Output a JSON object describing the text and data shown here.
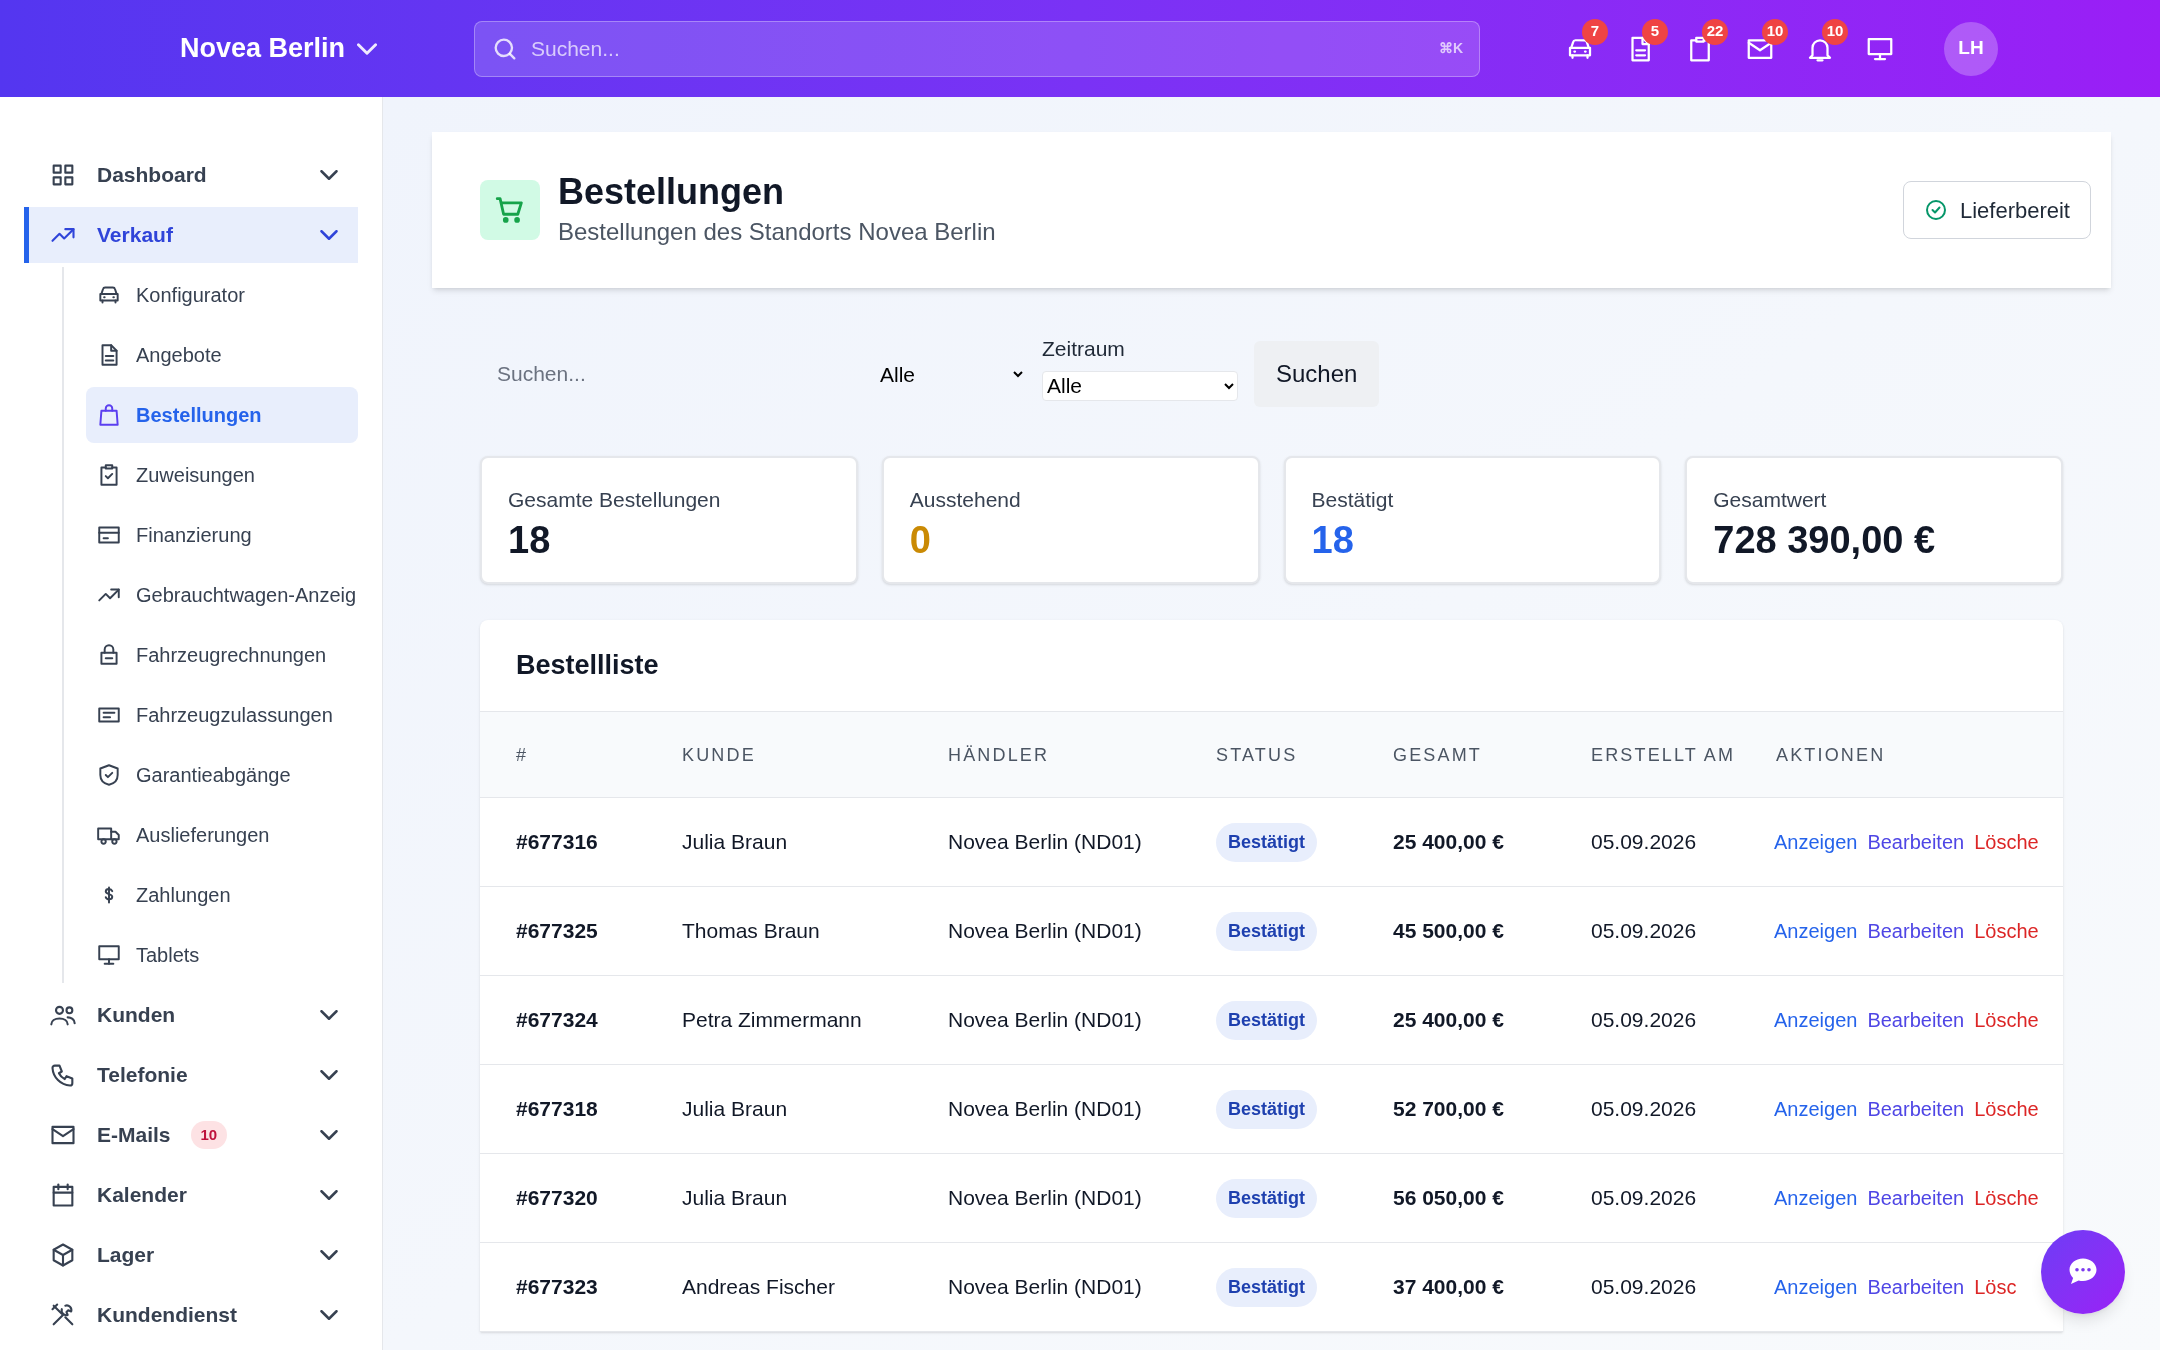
{
  "header": {
    "brand": "Novea Berlin",
    "search": {
      "placeholder": "Suchen...",
      "shortcut": "⌘K"
    },
    "notifications": [
      {
        "count": "7"
      },
      {
        "count": "5"
      },
      {
        "count": "22"
      },
      {
        "count": "10"
      },
      {
        "count": "10"
      }
    ],
    "avatar": "LH"
  },
  "sidebar": {
    "items": [
      {
        "label": "Dashboard",
        "selected": false
      },
      {
        "label": "Verkauf",
        "selected": true,
        "children": [
          {
            "label": "Konfigurator",
            "selected": false
          },
          {
            "label": "Angebote",
            "selected": false
          },
          {
            "label": "Bestellungen",
            "selected": true
          },
          {
            "label": "Zuweisungen",
            "selected": false
          },
          {
            "label": "Finanzierung",
            "selected": false
          },
          {
            "label": "Gebrauchtwagen-Anzeig",
            "selected": false
          },
          {
            "label": "Fahrzeugrechnungen",
            "selected": false
          },
          {
            "label": "Fahrzeugzulassungen",
            "selected": false
          },
          {
            "label": "Garantieabgänge",
            "selected": false
          },
          {
            "label": "Auslieferungen",
            "selected": false
          },
          {
            "label": "Zahlungen",
            "selected": false
          },
          {
            "label": "Tablets",
            "selected": false
          }
        ]
      },
      {
        "label": "Kunden",
        "selected": false
      },
      {
        "label": "Telefonie",
        "selected": false
      },
      {
        "label": "E-Mails",
        "selected": false,
        "badge": "10"
      },
      {
        "label": "Kalender",
        "selected": false
      },
      {
        "label": "Lager",
        "selected": false
      },
      {
        "label": "Kundendienst",
        "selected": false
      }
    ]
  },
  "page": {
    "title": "Bestellungen",
    "subtitle": "Bestellungen des Standorts Novea Berlin",
    "action": "Lieferbereit"
  },
  "filters": {
    "search": {
      "placeholder": "Suchen..."
    },
    "status": {
      "value": "Alle"
    },
    "period": {
      "label": "Zeitraum",
      "value": "Alle"
    },
    "button": "Suchen"
  },
  "stats": [
    {
      "label": "Gesamte Bestellungen",
      "value": "18",
      "color": "#111827"
    },
    {
      "label": "Ausstehend",
      "value": "0",
      "color": "#ca8a04"
    },
    {
      "label": "Bestätigt",
      "value": "18",
      "color": "#2563eb"
    },
    {
      "label": "Gesamtwert",
      "value": "728 390,00 €",
      "color": "#111827"
    }
  ],
  "table": {
    "title": "Bestellliste",
    "columns": [
      "#",
      "KUNDE",
      "HÄNDLER",
      "STATUS",
      "GESAMT",
      "ERSTELLT AM",
      "AKTIONEN"
    ],
    "rows": [
      {
        "id": "#677316",
        "customer": "Julia Braun",
        "dealer": "Novea Berlin (ND01)",
        "status": "Bestätigt",
        "total": "25 400,00 €",
        "created": "05.09.2026",
        "actions": [
          "Anzeigen",
          "Bearbeiten",
          "Lösche"
        ]
      },
      {
        "id": "#677325",
        "customer": "Thomas Braun",
        "dealer": "Novea Berlin (ND01)",
        "status": "Bestätigt",
        "total": "45 500,00 €",
        "created": "05.09.2026",
        "actions": [
          "Anzeigen",
          "Bearbeiten",
          "Lösche"
        ]
      },
      {
        "id": "#677324",
        "customer": "Petra Zimmermann",
        "dealer": "Novea Berlin (ND01)",
        "status": "Bestätigt",
        "total": "25 400,00 €",
        "created": "05.09.2026",
        "actions": [
          "Anzeigen",
          "Bearbeiten",
          "Lösche"
        ]
      },
      {
        "id": "#677318",
        "customer": "Julia Braun",
        "dealer": "Novea Berlin (ND01)",
        "status": "Bestätigt",
        "total": "52 700,00 €",
        "created": "05.09.2026",
        "actions": [
          "Anzeigen",
          "Bearbeiten",
          "Lösche"
        ]
      },
      {
        "id": "#677320",
        "customer": "Julia Braun",
        "dealer": "Novea Berlin (ND01)",
        "status": "Bestätigt",
        "total": "56 050,00 €",
        "created": "05.09.2026",
        "actions": [
          "Anzeigen",
          "Bearbeiten",
          "Lösche"
        ]
      },
      {
        "id": "#677323",
        "customer": "Andreas Fischer",
        "dealer": "Novea Berlin (ND01)",
        "status": "Bestätigt",
        "total": "37 400,00 €",
        "created": "05.09.2026",
        "actions": [
          "Anzeigen",
          "Bearbeiten",
          "Lösc"
        ]
      }
    ]
  }
}
